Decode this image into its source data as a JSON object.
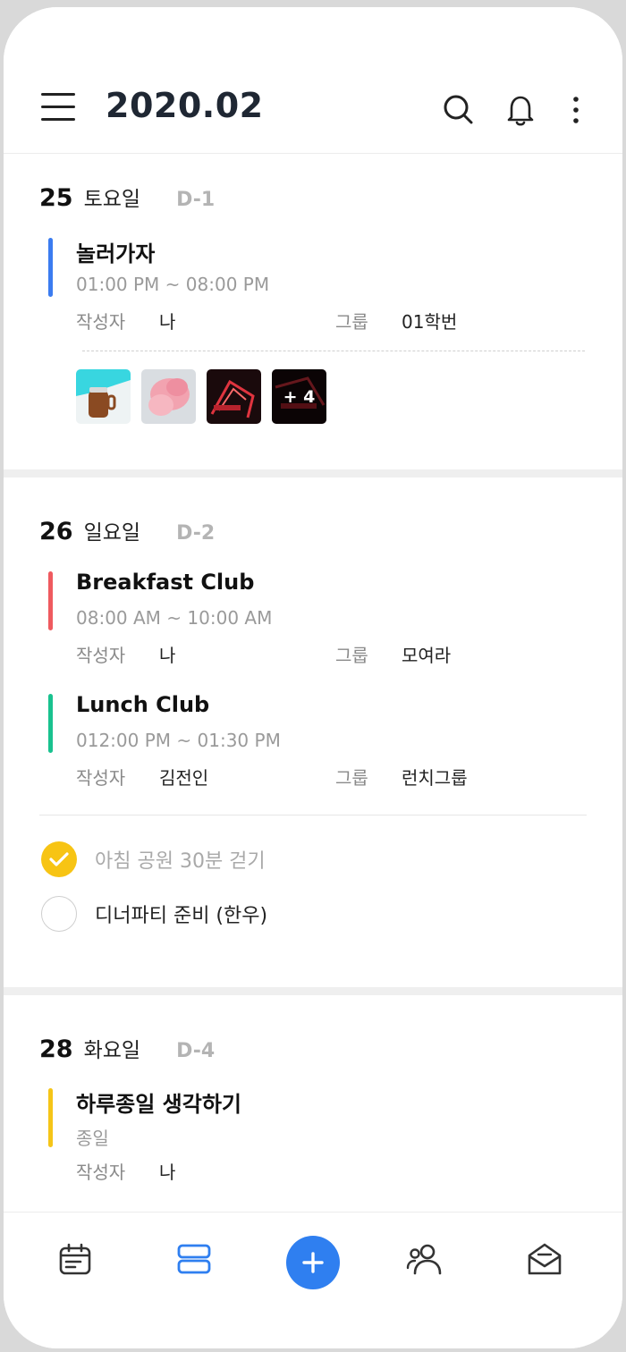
{
  "header": {
    "title": "2020.02",
    "menu_icon": "hamburger-menu-icon",
    "search_icon": "search-icon",
    "bell_icon": "bell-icon",
    "more_icon": "more-vertical-icon"
  },
  "days": [
    {
      "date": "25",
      "weekday": "토요일",
      "dday": "D-1",
      "events": [
        {
          "title": "놀러가자",
          "time": "01:00 PM ~ 08:00 PM",
          "color": "#3b7cf0",
          "author_label": "작성자",
          "author": "나",
          "group_label": "그룹",
          "group": "01학번"
        }
      ],
      "photos": {
        "more_label": "+ 4"
      }
    },
    {
      "date": "26",
      "weekday": "일요일",
      "dday": "D-2",
      "events": [
        {
          "title": "Breakfast Club",
          "time": "08:00 AM ~ 10:00 AM",
          "color": "#ef5a5f",
          "author_label": "작성자",
          "author": "나",
          "group_label": "그룹",
          "group": "모여라"
        },
        {
          "title": "Lunch Club",
          "time": "012:00 PM ~ 01:30 PM",
          "color": "#19c28f",
          "author_label": "작성자",
          "author": "김전인",
          "group_label": "그룹",
          "group": "런치그룹"
        }
      ],
      "todos": [
        {
          "label": "아침 공원 30분 걷기",
          "done": true
        },
        {
          "label": "디너파티 준비 (한우)",
          "done": false
        }
      ]
    },
    {
      "date": "28",
      "weekday": "화요일",
      "dday": "D-4",
      "events": [
        {
          "title": "하루종일 생각하기",
          "time": "종일",
          "color": "#f5c518",
          "author_label": "작성자",
          "author": "나"
        },
        {
          "color": "#7a5cf0"
        }
      ]
    }
  ],
  "tabbar": {
    "tabs": [
      {
        "icon": "calendar-icon",
        "active": false
      },
      {
        "icon": "list-view-icon",
        "active": true
      },
      {
        "icon": "add-icon",
        "active": false
      },
      {
        "icon": "friends-icon",
        "active": false
      },
      {
        "icon": "mail-icon",
        "active": false
      }
    ],
    "active_color": "#2f7ff0",
    "inactive_color": "#333333"
  }
}
